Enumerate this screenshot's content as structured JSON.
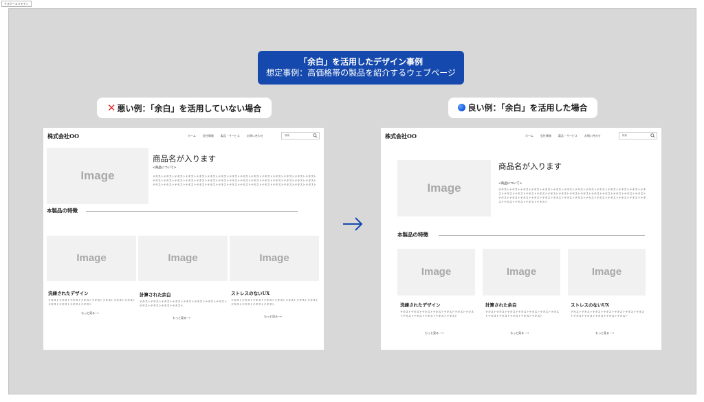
{
  "tag": "ケスケースメモディ",
  "banner": {
    "title": "「余白」を活用したデザイン事例",
    "subtitle": "想定事例：高価格帯の製品を紹介するウェブページ"
  },
  "labels": {
    "bad": "悪い例：「余白」を活用していない場合",
    "good": "良い例：「余白」を活用した場合"
  },
  "site": {
    "logo": "株式会社OO",
    "nav": [
      "ホーム",
      "会社情報",
      "製品・サービス",
      "お問い合わせ"
    ],
    "search_placeholder": "検索",
    "image_label": "Image",
    "product_name": "商品名が入ります",
    "about": "<商品について>",
    "body_text": "テキストテキストテキストテキストテキストテキストテキストテキストテキストテキストテキストテキストテキストテキストテキストテキストテキストテキストテキストテキストテキストテキストテキストテキストテキストテキストテキストテキストテキストテキストテキストテキストテキストテキストテキストテキストテキストテキストテキストテキストテキストテキストテキストテキストテキスト",
    "section_title": "本製品の特徴",
    "features": [
      {
        "title": "洗練されたデザイン",
        "text": "テキストテキストテキストテキストテキストテキストテキストテキストテキストテキストテキストテキスト"
      },
      {
        "title": "計算された余白",
        "text": "テキストテキストテキストテキストテキストテキストテキストテキストテキストテキストテキストテキスト"
      },
      {
        "title": "ストレスのないUX",
        "text": "テキストテキストテキストテキストテキストテキストテキストテキストテキストテキストテキストテキスト"
      }
    ],
    "more": "もっと見る"
  },
  "colors": {
    "canvas": "#d8d8d8",
    "banner": "#1549ad",
    "bad_mark": "#e0272b",
    "good_mark": "#1a5fd8",
    "image_placeholder": "#f1f1f1"
  }
}
